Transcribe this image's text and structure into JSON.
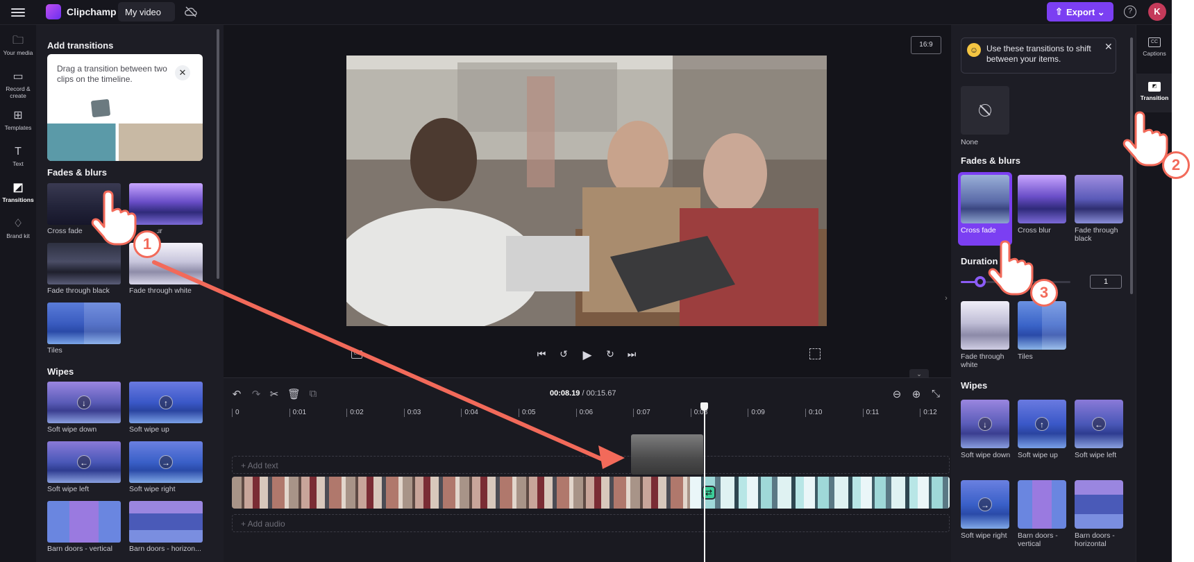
{
  "app": {
    "name": "Clipchamp",
    "video_title": "My video",
    "export_label": "Export",
    "avatar_initial": "K",
    "accent": "#7b3ff2"
  },
  "rail": [
    {
      "label": "Your media",
      "icon": "folder-icon"
    },
    {
      "label": "Record & create",
      "icon": "camera-icon"
    },
    {
      "label": "Templates",
      "icon": "templates-icon"
    },
    {
      "label": "Text",
      "icon": "text-icon"
    },
    {
      "label": "Transitions",
      "icon": "transitions-icon",
      "active": true
    },
    {
      "label": "Brand kit",
      "icon": "brand-kit-icon"
    }
  ],
  "left_panel": {
    "title": "Add transitions",
    "tip": "Drag a transition between two clips on the timeline.",
    "sections": [
      {
        "title": "Fades & blurs",
        "items": [
          "Cross fade",
          "Cross blur",
          "Fade through black",
          "Fade through white",
          "Tiles"
        ]
      },
      {
        "title": "Wipes",
        "items": [
          "Soft wipe down",
          "Soft wipe up",
          "Soft wipe left",
          "Soft wipe right",
          "Barn doors - vertical",
          "Barn doors - horizon..."
        ]
      }
    ]
  },
  "preview": {
    "aspect_ratio": "16:9"
  },
  "timeline": {
    "current_time": "00:08.19",
    "total_time": "/ 00:15.67",
    "ticks": [
      "0",
      "0:01",
      "0:02",
      "0:03",
      "0:04",
      "0:05",
      "0:06",
      "0:07",
      "0:08",
      "0:09",
      "0:10",
      "0:11",
      "0:12"
    ],
    "add_text": "+ Add text",
    "add_audio": "+ Add audio"
  },
  "right_panel": {
    "tip": "Use these transitions to shift between your items.",
    "none_label": "None",
    "fades_title": "Fades & blurs",
    "fades": [
      "Cross fade",
      "Cross blur",
      "Fade through black",
      "Fade through white",
      "Tiles"
    ],
    "duration_label": "Duration",
    "duration_value": "1",
    "wipes_title": "Wipes",
    "wipes": [
      "Soft wipe down",
      "Soft wipe up",
      "Soft wipe left",
      "Soft wipe right",
      "Barn doors - vertical",
      "Barn doors - horizontal"
    ]
  },
  "right_rail": [
    {
      "label": "Captions",
      "icon": "captions-icon"
    },
    {
      "label": "Transition",
      "icon": "transition-icon",
      "active": true
    }
  ],
  "annotations": {
    "steps": [
      "1",
      "2",
      "3"
    ],
    "color": "#f26a5a"
  }
}
